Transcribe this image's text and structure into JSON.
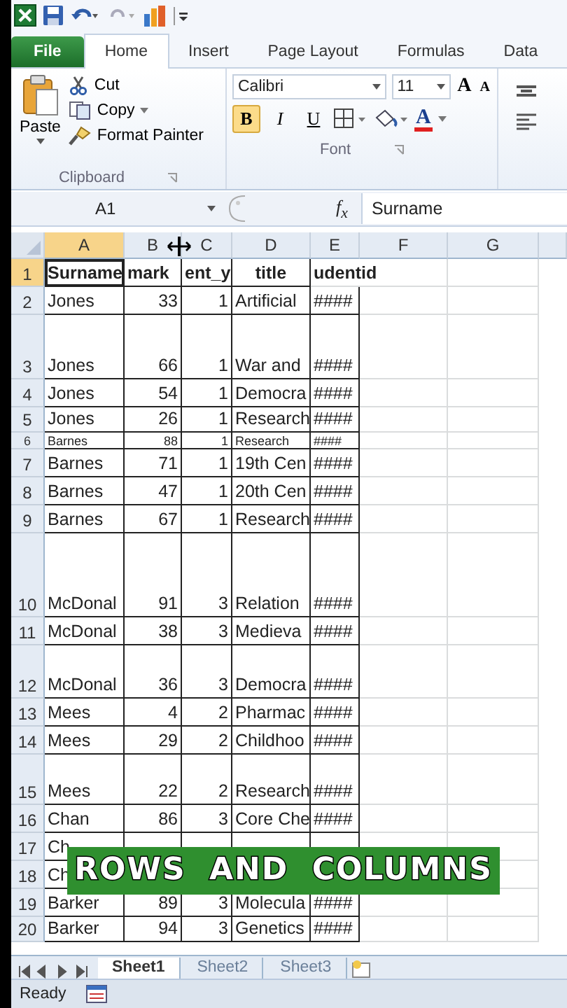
{
  "ribbon_tabs": [
    {
      "label": "File",
      "kind": "file",
      "selected": false
    },
    {
      "label": "Home",
      "kind": "tab",
      "selected": true
    },
    {
      "label": "Insert",
      "kind": "tab",
      "selected": false
    },
    {
      "label": "Page Layout",
      "kind": "tab",
      "selected": false
    },
    {
      "label": "Formulas",
      "kind": "tab",
      "selected": false
    },
    {
      "label": "Data",
      "kind": "tab",
      "selected": false
    }
  ],
  "clipboard": {
    "paste": "Paste",
    "cut": "Cut",
    "copy": "Copy",
    "format_painter": "Format Painter",
    "group_label": "Clipboard"
  },
  "font": {
    "family": "Calibri",
    "size": "11",
    "grow": "A",
    "shrink": "A",
    "font_color": "A",
    "group_label": "Font",
    "styles": [
      {
        "label": "B",
        "kind": "bold",
        "on": true
      },
      {
        "label": "I",
        "kind": "italic",
        "on": false
      },
      {
        "label": "U",
        "kind": "underline",
        "on": false
      }
    ]
  },
  "formula_bar": {
    "name_box": "A1",
    "fx": "f$_{x}$",
    "value": "Surname"
  },
  "columns": [
    {
      "label": "A",
      "selected": true
    },
    {
      "label": "B",
      "selected": false
    },
    {
      "label": "C",
      "selected": false
    },
    {
      "label": "D",
      "selected": false
    },
    {
      "label": "E",
      "selected": false
    },
    {
      "label": "F",
      "selected": false
    },
    {
      "label": "G",
      "selected": false
    }
  ],
  "rows": [
    {
      "number": "1",
      "selected": true,
      "cells": [
        "Surname",
        "mark",
        "ent_y",
        "title",
        "udentid"
      ]
    },
    {
      "number": "2",
      "selected": false,
      "cells": [
        "Jones",
        "33",
        "1",
        "Artificial",
        "####"
      ]
    },
    {
      "number": "3",
      "selected": false,
      "cells": [
        "Jones",
        "66",
        "1",
        "War and",
        "####"
      ]
    },
    {
      "number": "4",
      "selected": false,
      "cells": [
        "Jones",
        "54",
        "1",
        "Democra",
        "####"
      ]
    },
    {
      "number": "5",
      "selected": false,
      "cells": [
        "Jones",
        "26",
        "1",
        "Research",
        "####"
      ]
    },
    {
      "number": "6",
      "selected": false,
      "cells": [
        "Barnes",
        "88",
        "1",
        "Research",
        "####"
      ]
    },
    {
      "number": "7",
      "selected": false,
      "cells": [
        "Barnes",
        "71",
        "1",
        "19th Cen",
        "####"
      ]
    },
    {
      "number": "8",
      "selected": false,
      "cells": [
        "Barnes",
        "47",
        "1",
        "20th Cen",
        "####"
      ]
    },
    {
      "number": "9",
      "selected": false,
      "cells": [
        "Barnes",
        "67",
        "1",
        "Research",
        "####"
      ]
    },
    {
      "number": "10",
      "selected": false,
      "cells": [
        "McDonal",
        "91",
        "3",
        "Relation",
        "####"
      ]
    },
    {
      "number": "11",
      "selected": false,
      "cells": [
        "McDonal",
        "38",
        "3",
        "Medieva",
        "####"
      ]
    },
    {
      "number": "12",
      "selected": false,
      "cells": [
        "McDonal",
        "36",
        "3",
        "Democra",
        "####"
      ]
    },
    {
      "number": "13",
      "selected": false,
      "cells": [
        "Mees",
        "4",
        "2",
        "Pharmac",
        "####"
      ]
    },
    {
      "number": "14",
      "selected": false,
      "cells": [
        "Mees",
        "29",
        "2",
        "Childhoo",
        "####"
      ]
    },
    {
      "number": "15",
      "selected": false,
      "cells": [
        "Mees",
        "22",
        "2",
        "Research",
        "####"
      ]
    },
    {
      "number": "16",
      "selected": false,
      "cells": [
        "Chan",
        "86",
        "3",
        "Core Che",
        "####"
      ]
    },
    {
      "number": "17",
      "selected": false,
      "cells": [
        "Ch"
      ]
    },
    {
      "number": "18",
      "selected": false,
      "cells": [
        "Ch"
      ]
    },
    {
      "number": "19",
      "selected": false,
      "cells": [
        "Barker",
        "89",
        "3",
        "Molecula",
        "####"
      ]
    },
    {
      "number": "20",
      "selected": false,
      "cells": [
        "Barker",
        "94",
        "3",
        "Genetics",
        "####"
      ]
    }
  ],
  "sheet_tabs": [
    {
      "label": "Sheet1",
      "selected": true
    },
    {
      "label": "Sheet2",
      "selected": false
    },
    {
      "label": "Sheet3",
      "selected": false
    }
  ],
  "status": "Ready",
  "caption": "ROWS AND COLUMNS"
}
